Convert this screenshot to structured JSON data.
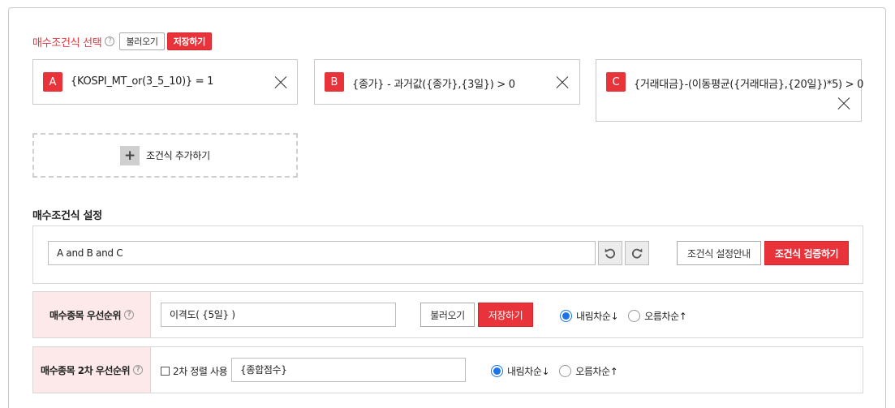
{
  "buy_condition": {
    "title": "매수조건식 선택",
    "help_glyph": "?",
    "load_label": "불러오기",
    "save_label": "저장하기",
    "conditions": [
      {
        "badge": "A",
        "text": "{KOSPI_MT_or(3_5_10)} = 1"
      },
      {
        "badge": "B",
        "text": "{종가} - 과거값({종가},{3일}) > 0"
      },
      {
        "badge": "C",
        "text": "{거래대금}-(이동평균({거래대금},{20일})*5) > 0"
      }
    ],
    "add_label": "조건식 추가하기",
    "add_glyph": "+"
  },
  "settings": {
    "title": "매수조건식 설정",
    "formula_value": "A and B and C",
    "undo_icon": "undo-icon",
    "redo_icon": "redo-icon",
    "guide_label": "조건식 설정안내",
    "verify_label": "조건식 검증하기"
  },
  "priority": {
    "label": "매수종목 우선순위",
    "input_value": "이격도( {5일} )",
    "load_label": "불러오기",
    "save_label": "저장하기",
    "desc_label": "내림차순↓",
    "asc_label": "오름차순↑",
    "selected": "desc"
  },
  "priority2": {
    "label": "매수종목 2차 우선순위",
    "checkbox_label": "2차 정렬 사용",
    "input_value": "{종합점수}",
    "desc_label": "내림차순↓",
    "asc_label": "오름차순↑",
    "selected": "desc"
  },
  "colors": {
    "accent": "#e8333a",
    "label_bg": "#fde9e9",
    "radio": "#1a73e8"
  }
}
